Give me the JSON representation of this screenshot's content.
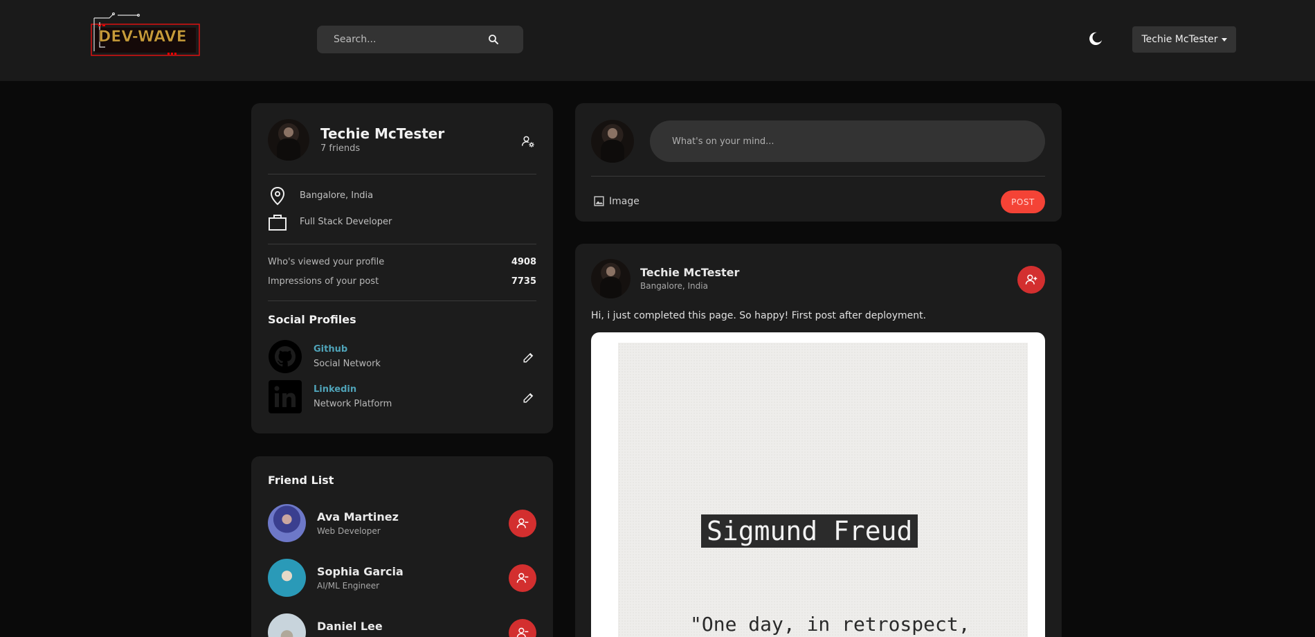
{
  "navbar": {
    "logo_text": "DEV-WAVE",
    "search_placeholder": "Search...",
    "user_menu_label": "Techie McTester"
  },
  "profile": {
    "name": "Techie McTester",
    "friends": "7 friends",
    "location": "Bangalore, India",
    "occupation": "Full Stack Developer",
    "stats": [
      {
        "label": "Who's viewed your profile",
        "value": "4908"
      },
      {
        "label": "Impressions of your post",
        "value": "7735"
      }
    ],
    "social_title": "Social Profiles",
    "social": [
      {
        "name": "Github",
        "sub": "Social Network",
        "icon": "github-icon"
      },
      {
        "name": "Linkedin",
        "sub": "Network Platform",
        "icon": "linkedin-icon"
      }
    ]
  },
  "friend_list": {
    "title": "Friend List",
    "items": [
      {
        "name": "Ava Martinez",
        "role": "Web Developer"
      },
      {
        "name": "Sophia Garcia",
        "role": "AI/ML Engineer"
      },
      {
        "name": "Daniel Lee",
        "role": ""
      }
    ]
  },
  "composer": {
    "placeholder": "What's on your mind...",
    "image_label": "Image",
    "post_label": "POST"
  },
  "post": {
    "author": "Techie McTester",
    "location": "Bangalore, India",
    "text": "Hi, i just completed this page. So happy! First post after deployment.",
    "image_title": "Sigmund Freud",
    "image_quote": "\"One day, in retrospect,"
  },
  "colors": {
    "accent_red": "#d32f2f",
    "post_button": "#f44336",
    "link_teal": "#4fa3b8",
    "card_bg": "#1c1c1c",
    "page_bg": "#0a0a0a"
  }
}
